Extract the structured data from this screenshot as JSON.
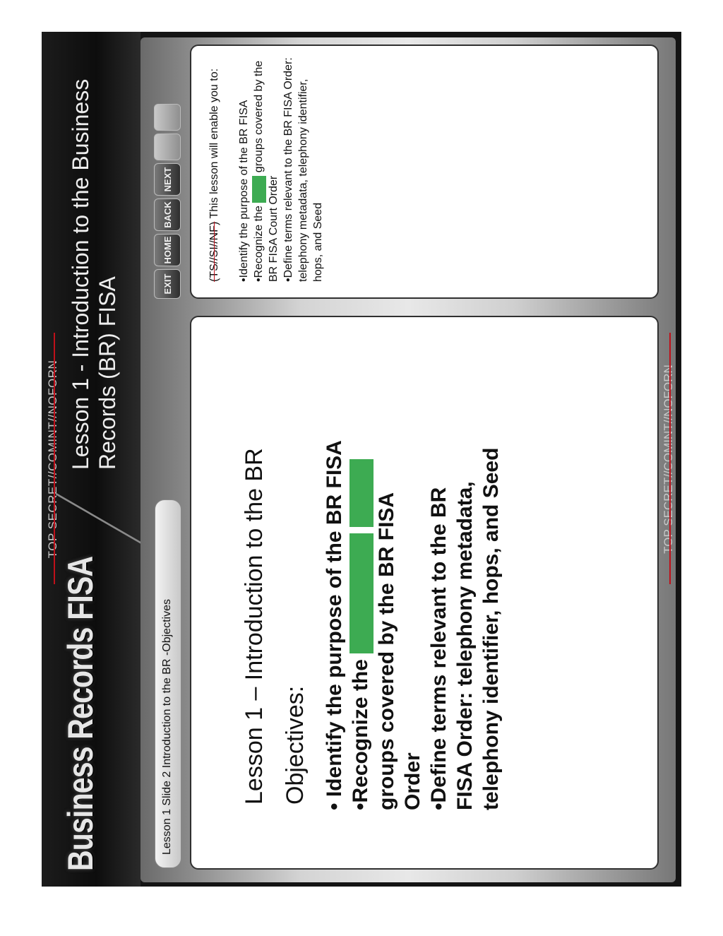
{
  "classification": {
    "top": "TOP SECRET//COMINT//NOFORN",
    "bottom": "TOP SECRET//COMINT//NOFORN"
  },
  "app": {
    "logo_text": "Business Records FISA"
  },
  "lesson": {
    "title": "Lesson 1 - Introduction to the Business Records (BR) FISA"
  },
  "breadcrumb": "Lesson 1 Slide 2 Introduction to the BR -Objectives",
  "nav": {
    "exit": "EXIT",
    "home": "HOME",
    "back": "BACK",
    "next": "NEXT"
  },
  "main": {
    "heading": "Lesson 1 – Introduction to the BR",
    "objectives_label": "Objectives:",
    "obj1": "Identify the purpose of the BR FISA",
    "obj2_a": "Recognize the",
    "obj2_b": "groups covered by the BR FISA Order",
    "obj3": "Define terms relevant to the BR FISA Order:  telephony metadata, telephony identifier, hops, and Seed"
  },
  "summary": {
    "marking": "(TS//SI//NF)",
    "intro": "This lesson will enable you to:",
    "item1": "Identify the purpose of the BR FISA",
    "item2_a": "Recognize the",
    "item2_b": "groups covered by the BR FISA Court Order",
    "item3": "Define terms relevant to the BR FISA Order:  telephony metadata, telephony identifier, hops, and Seed"
  },
  "colors": {
    "redaction": "#3dab52",
    "strike": "#c0101a"
  }
}
